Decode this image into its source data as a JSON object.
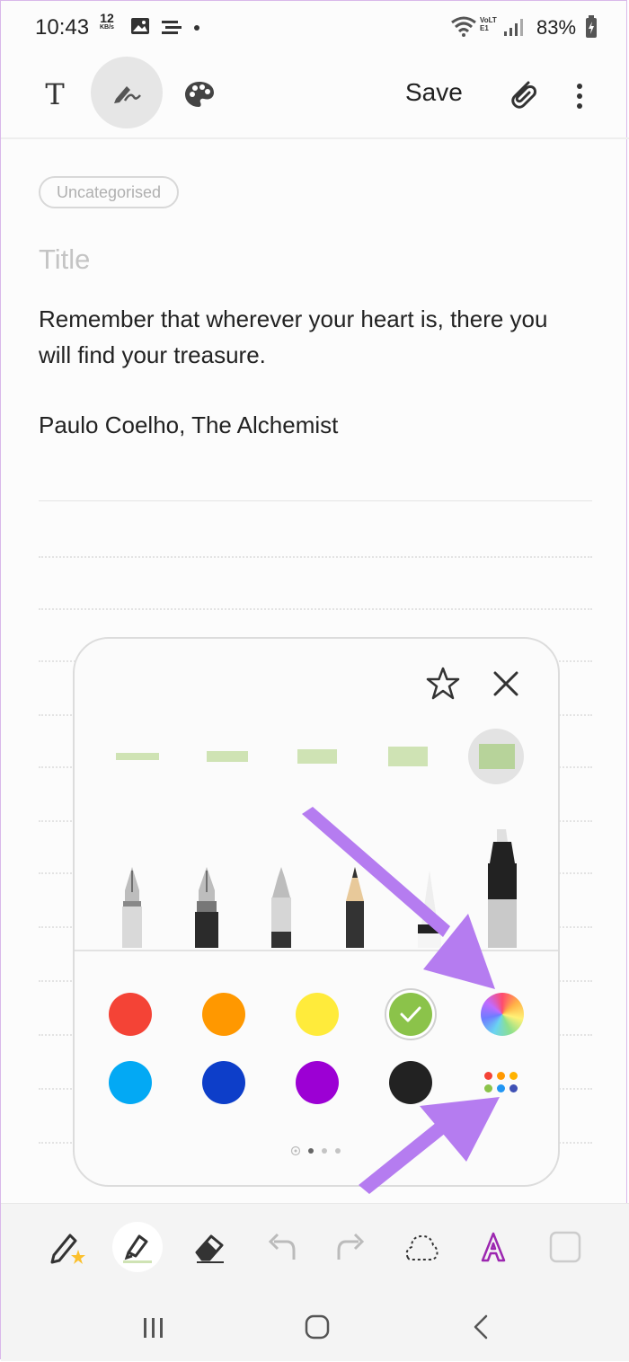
{
  "status_bar": {
    "time": "10:43",
    "data_speed_value": "12",
    "data_speed_unit": "KB/s",
    "network_label": "VoLTE1",
    "battery": "83%",
    "icons": [
      "gallery-icon",
      "cast-icon",
      "dot-icon",
      "wifi-icon",
      "signal-icon",
      "battery-icon"
    ]
  },
  "toolbar": {
    "text_mode_icon": "T",
    "pen_mode_icon": "handwriting-icon",
    "palette_icon": "palette-icon",
    "save_label": "Save",
    "attach_icon": "paperclip-icon",
    "more_icon": "more-vertical-icon"
  },
  "note": {
    "category": "Uncategorised",
    "title_placeholder": "Title",
    "body_line1": "Remember that wherever your heart is, there you will find your treasure.",
    "body_line2": "Paulo Coelho, The Alchemist"
  },
  "pen_settings": {
    "favorite_icon": "star-icon",
    "close_icon": "close-icon",
    "size_options": 5,
    "selected_size_index": 4,
    "pen_types": [
      "fountain-pen",
      "calligraphy-pen",
      "pen",
      "pencil",
      "highlighter",
      "marker"
    ],
    "colors": [
      {
        "name": "red",
        "hex": "#f44336"
      },
      {
        "name": "orange",
        "hex": "#ff9800"
      },
      {
        "name": "yellow",
        "hex": "#ffeb3b"
      },
      {
        "name": "green",
        "hex": "#8bc34a",
        "selected": true
      },
      {
        "name": "spectrum",
        "hex": "gradient"
      },
      {
        "name": "sky-blue",
        "hex": "#03a9f4"
      },
      {
        "name": "blue",
        "hex": "#0d3ec9"
      },
      {
        "name": "purple",
        "hex": "#9c00d4"
      },
      {
        "name": "black",
        "hex": "#222222"
      },
      {
        "name": "more-colors",
        "hex": "palette"
      }
    ],
    "page_count": 4,
    "current_page": 1
  },
  "drawing_toolbar": {
    "tools": [
      "favorite-pen-icon",
      "highlighter-icon",
      "eraser-icon",
      "undo-icon",
      "redo-icon",
      "lasso-icon",
      "text-style-icon",
      "shape-icon"
    ],
    "active_tool": "highlighter-icon"
  },
  "nav_bar": {
    "buttons": [
      "recents-icon",
      "home-icon",
      "back-icon"
    ]
  },
  "accent_colors": {
    "annotation_arrow": "#b57cf0",
    "highlight_green": "#cfe3b4"
  }
}
